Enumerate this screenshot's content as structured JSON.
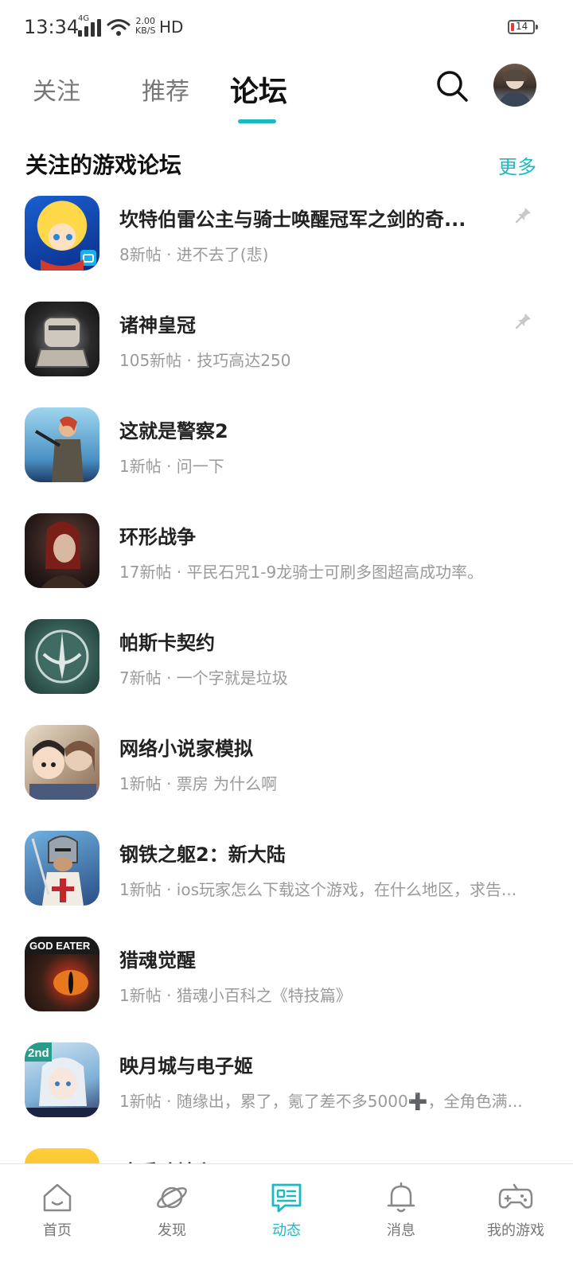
{
  "status_bar": {
    "time": "13:34",
    "network_type": "4G",
    "speed_value": "2.00",
    "speed_unit": "KB/S",
    "hd": "HD",
    "battery": "14"
  },
  "tabs": [
    {
      "label": "关注"
    },
    {
      "label": "推荐"
    },
    {
      "label": "论坛"
    }
  ],
  "active_tab": "论坛",
  "section": {
    "title": "关注的游戏论坛",
    "more": "更多"
  },
  "forums": [
    {
      "name": "坎特伯雷公主与骑士唤醒冠军之剑的奇...",
      "subtitle": "8新帖 · 进不去了(悲)",
      "pinned": true,
      "icon": "kanterbury-game-icon"
    },
    {
      "name": "诸神皇冠",
      "subtitle": "105新帖 · 技巧高达250",
      "pinned": true,
      "icon": "crown-of-gods-game-icon"
    },
    {
      "name": "这就是警察2",
      "subtitle": "1新帖 · 问一下",
      "pinned": false,
      "icon": "this-is-the-police-game-icon"
    },
    {
      "name": "环形战争",
      "subtitle": "17新帖 · 平民石咒1-9龙骑士可刷多图超高成功率。",
      "pinned": false,
      "icon": "annulus-game-icon"
    },
    {
      "name": "帕斯卡契约",
      "subtitle": "7新帖 · 一个字就是垃圾",
      "pinned": false,
      "icon": "pascal-contract-game-icon"
    },
    {
      "name": "网络小说家模拟",
      "subtitle": "1新帖 · 票房 为什么啊",
      "pinned": false,
      "icon": "web-novelist-game-icon"
    },
    {
      "name": "钢铁之躯2：新大陆",
      "subtitle": "1新帖 · ios玩家怎么下载这个游戏，在什么地区，求告...",
      "pinned": false,
      "icon": "steel-body-game-icon"
    },
    {
      "name": "猎魂觉醒",
      "subtitle": "1新帖 · 猎魂小百科之《特技篇》",
      "pinned": false,
      "icon": "god-eater-game-icon"
    },
    {
      "name": "映月城与电子姬",
      "subtitle": "1新帖 · 随缘出，累了，氪了差不多5000➕，全角色满...",
      "pinned": false,
      "icon": "moon-city-game-icon"
    },
    {
      "name": "欢乐斗地主",
      "subtitle": "",
      "pinned": false,
      "icon": "happy-landlord-game-icon"
    }
  ],
  "bottom_nav": [
    {
      "label": "首页",
      "icon": "home-icon"
    },
    {
      "label": "发现",
      "icon": "planet-icon"
    },
    {
      "label": "动态",
      "icon": "feed-icon"
    },
    {
      "label": "消息",
      "icon": "bell-icon"
    },
    {
      "label": "我的游戏",
      "icon": "gamepad-icon"
    }
  ],
  "active_nav": "动态",
  "colors": {
    "accent": "#1bb9c2",
    "text_primary": "#222222",
    "text_secondary": "#9a9a9a"
  }
}
